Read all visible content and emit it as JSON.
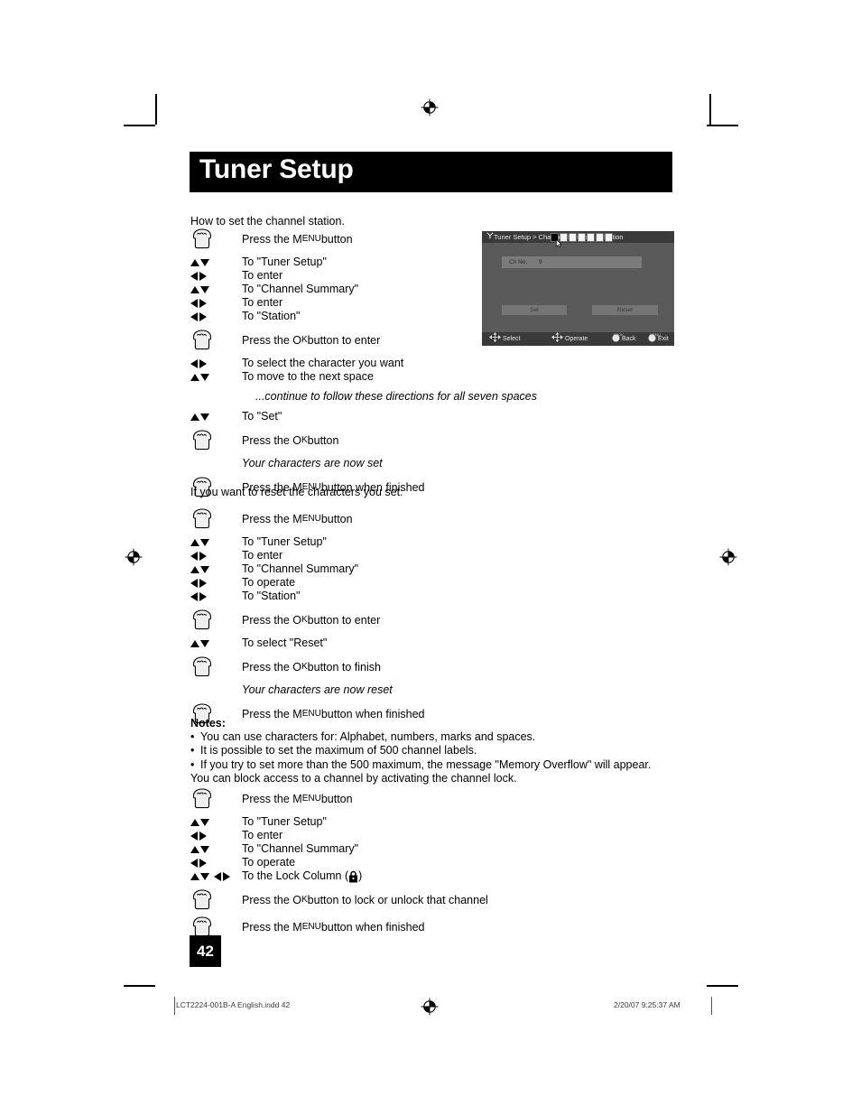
{
  "page": {
    "title": "Tuner Setup",
    "page_number": "42"
  },
  "intro": {
    "line1": "How to set the channel station.",
    "line2": "If you want to reset the characters you set:"
  },
  "sections": {
    "set_station": [
      {
        "key": "hand",
        "text_pre": "Press the ",
        "sc": "Menu",
        "text_post": " button",
        "tall": true
      },
      {
        "key": "ud",
        "text_pre": "To \"Tuner Setup\"",
        "sc": "",
        "text_post": ""
      },
      {
        "key": "lr",
        "text_pre": "To enter",
        "sc": "",
        "text_post": ""
      },
      {
        "key": "ud",
        "text_pre": "To \"Channel Summary\"",
        "sc": "",
        "text_post": ""
      },
      {
        "key": "lr",
        "text_pre": "To enter",
        "sc": "",
        "text_post": ""
      },
      {
        "key": "lr",
        "text_pre": "To \"Station\"",
        "sc": "",
        "text_post": ""
      },
      {
        "key": "hand",
        "text_pre": "Press the ",
        "sc": "Ok",
        "text_post": " button to enter",
        "tall": true
      },
      {
        "key": "lr",
        "text_pre": "To select the character you want",
        "sc": "",
        "text_post": ""
      },
      {
        "key": "ud",
        "text_pre": "To move to the next space",
        "sc": "",
        "text_post": ""
      },
      {
        "key": "none",
        "text_pre": "...continue to follow these directions for all seven spaces",
        "sc": "",
        "text_post": "",
        "italic": true,
        "indent": true
      },
      {
        "key": "ud",
        "text_pre": "To \"Set\"",
        "sc": "",
        "text_post": ""
      },
      {
        "key": "hand",
        "text_pre": "Press the ",
        "sc": "Ok",
        "text_post": " button",
        "tall": true
      },
      {
        "key": "none",
        "text_pre": "Your characters are now set",
        "sc": "",
        "text_post": "",
        "italic": true
      },
      {
        "key": "hand",
        "text_pre": "Press the ",
        "sc": "Menu",
        "text_post": " button when finished",
        "tall": true
      }
    ],
    "reset_station": [
      {
        "key": "hand",
        "text_pre": "Press the ",
        "sc": "Menu",
        "text_post": " button",
        "tall": true
      },
      {
        "key": "ud",
        "text_pre": "To \"Tuner Setup\"",
        "sc": "",
        "text_post": ""
      },
      {
        "key": "lr",
        "text_pre": "To enter",
        "sc": "",
        "text_post": ""
      },
      {
        "key": "ud",
        "text_pre": "To \"Channel Summary\"",
        "sc": "",
        "text_post": ""
      },
      {
        "key": "lr",
        "text_pre": "To operate",
        "sc": "",
        "text_post": ""
      },
      {
        "key": "lr",
        "text_pre": "To \"Station\"",
        "sc": "",
        "text_post": ""
      },
      {
        "key": "hand",
        "text_pre": "Press the ",
        "sc": "Ok",
        "text_post": " button to enter",
        "tall": true
      },
      {
        "key": "ud",
        "text_pre": "To select \"Reset\"",
        "sc": "",
        "text_post": ""
      },
      {
        "key": "hand",
        "text_pre": "Press the ",
        "sc": "Ok",
        "text_post": " button to finish",
        "tall": true
      },
      {
        "key": "none",
        "text_pre": "Your characters are now reset",
        "sc": "",
        "text_post": "",
        "italic": true
      },
      {
        "key": "hand",
        "text_pre": "Press the ",
        "sc": "Menu",
        "text_post": " button when finished",
        "tall": true
      }
    ],
    "channel_lock": [
      {
        "key": "hand",
        "text_pre": "Press the ",
        "sc": "Menu",
        "text_post": " button",
        "tall": true
      },
      {
        "key": "ud",
        "text_pre": "To \"Tuner Setup\"",
        "sc": "",
        "text_post": ""
      },
      {
        "key": "lr",
        "text_pre": "To enter",
        "sc": "",
        "text_post": ""
      },
      {
        "key": "ud",
        "text_pre": "To \"Channel Summary\"",
        "sc": "",
        "text_post": ""
      },
      {
        "key": "lr",
        "text_pre": "To operate",
        "sc": "",
        "text_post": ""
      },
      {
        "key": "udlr",
        "text_pre": "To the Lock Column ( ",
        "sc": "",
        "text_post": " )",
        "lock": true
      },
      {
        "key": "hand",
        "text_pre": "Press the ",
        "sc": "Ok",
        "text_post": " button to lock or unlock that channel",
        "tall": true
      },
      {
        "key": "hand",
        "text_pre": "Press the ",
        "sc": "Menu",
        "text_post": " button when finished",
        "tall": true
      }
    ]
  },
  "notes": {
    "heading": "Notes:",
    "bullets": [
      "You can use characters for: Alphabet, numbers, marks and spaces.",
      "It is possible to set the maximum of 500 channel labels.",
      "If you try to set more than the 500 maximum, the message \"Memory Overflow\" will appear."
    ],
    "trailing_line": "You can block access to a channel by activating the channel lock."
  },
  "osd": {
    "breadcrumb": "Tuner Setup > Channel Summary > Station",
    "ch_label": "Ch No.",
    "ch_number": "9",
    "char_slots": 7,
    "selected_slot_index": 0,
    "buttons": {
      "set": "Set",
      "reset": "Reset"
    },
    "footer": [
      {
        "label": "Select",
        "cap": ""
      },
      {
        "label": "Operate",
        "cap": ""
      },
      {
        "label": "Back",
        "cap": "BACK"
      },
      {
        "label": "Exit",
        "cap": "MENU"
      }
    ]
  },
  "print_footer": {
    "left": "LCT2224-001B-A English.indd   42",
    "right": "2/20/07   9:25:37 AM"
  },
  "colors": {
    "banner_bg": "#000000",
    "banner_fg": "#ffffff",
    "osd_bg": "#5a5a5a",
    "osd_bar": "#3a3a3a",
    "osd_row": "#7b7b7b",
    "osd_button": "#757575"
  }
}
